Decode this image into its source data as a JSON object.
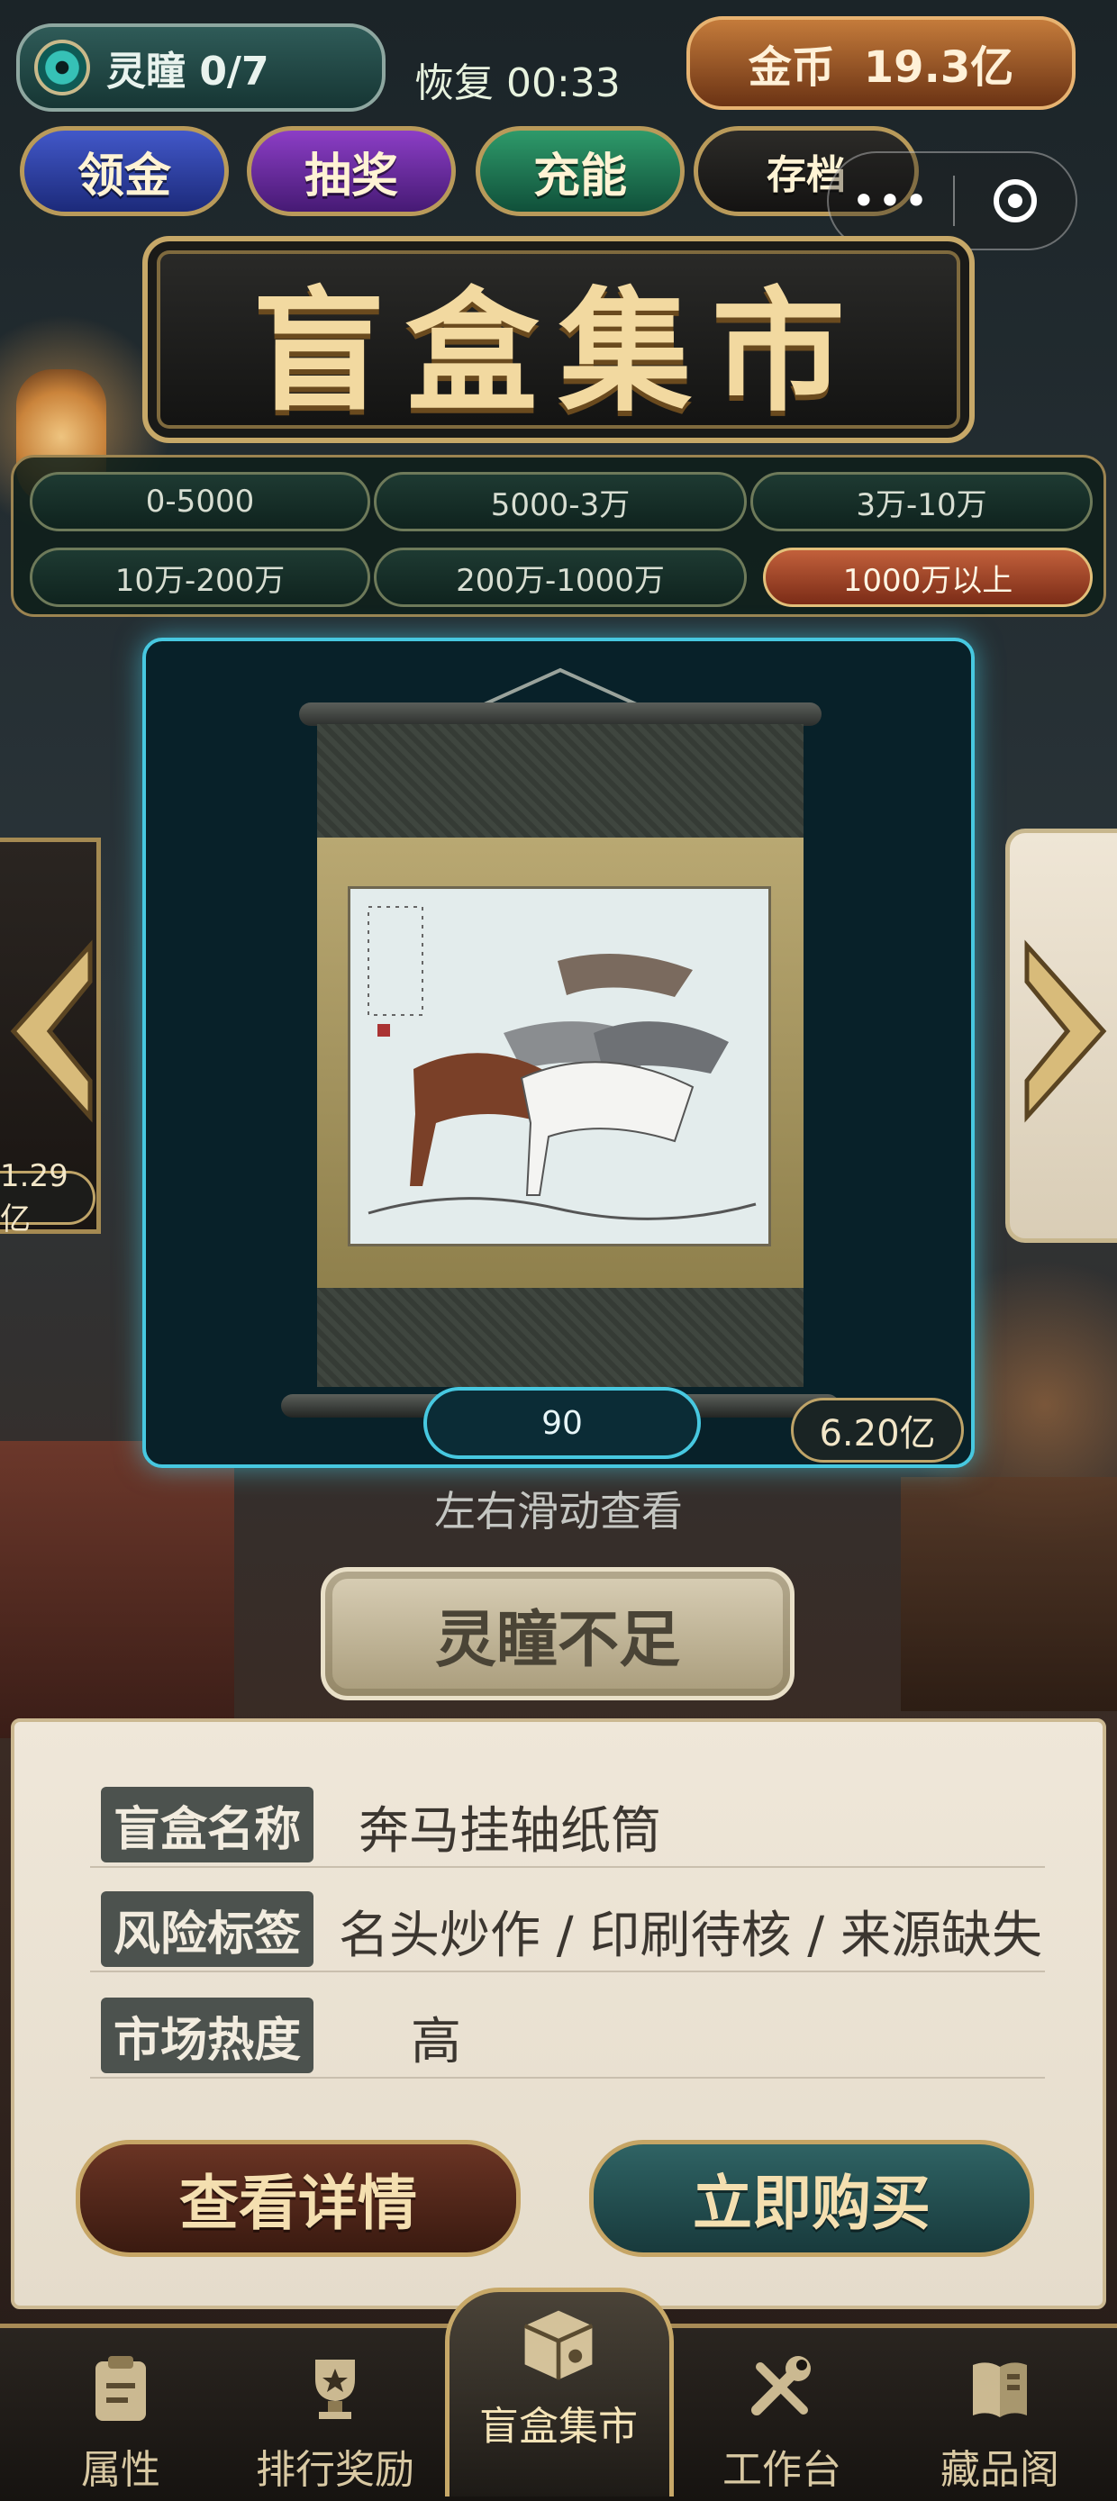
{
  "hud": {
    "eyes_label": "灵瞳 0/7",
    "recover_text": "恢复 00:33",
    "gold_label": "金币",
    "gold_value": "19.3亿"
  },
  "top_buttons": {
    "collect": "领金",
    "lottery": "抽奖",
    "recharge": "充能",
    "save": "存档"
  },
  "capsule": {
    "more": "•••"
  },
  "title": "盲盒集市",
  "price_filters": [
    {
      "label": "0-5000",
      "active": false
    },
    {
      "label": "5000-3万",
      "active": false
    },
    {
      "label": "3万-10万",
      "active": false
    },
    {
      "label": "10万-200万",
      "active": false
    },
    {
      "label": "200万-1000万",
      "active": false
    },
    {
      "label": "1000万以上",
      "active": true
    }
  ],
  "card": {
    "number": "90",
    "price": "6.20亿",
    "left_price": "1.29亿"
  },
  "swipe_hint": "左右滑动查看",
  "status_button": "灵瞳不足",
  "info": {
    "name_label": "盲盒名称",
    "name_value": "奔马挂轴纸筒",
    "risk_label": "风险标签",
    "risk_value": "名头炒作 / 印刷待核 / 来源缺失",
    "heat_label": "市场热度",
    "heat_value": "高"
  },
  "actions": {
    "detail": "查看详情",
    "buy": "立即购买"
  },
  "nav": [
    {
      "label": "属性",
      "icon": "clipboard-icon"
    },
    {
      "label": "排行奖励",
      "icon": "trophy-icon"
    },
    {
      "label": "盲盒集市",
      "icon": "box-icon"
    },
    {
      "label": "工作台",
      "icon": "tools-icon"
    },
    {
      "label": "藏品阁",
      "icon": "book-icon"
    }
  ],
  "colors": {
    "accent_gold": "#c7a868",
    "card_glow": "#47c8e0",
    "active_filter": "#c2603b"
  }
}
